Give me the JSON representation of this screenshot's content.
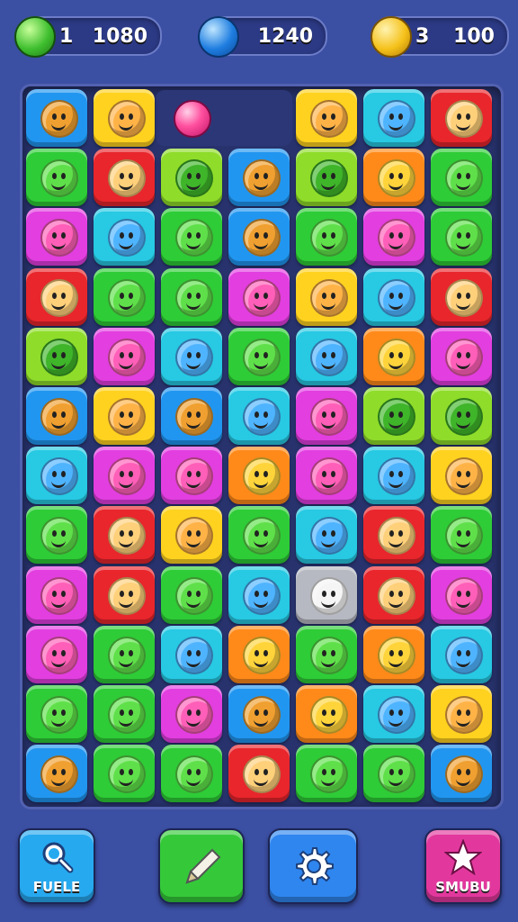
{
  "hud": {
    "green": {
      "count": "1",
      "score": "1080",
      "color": "#3fbf2f"
    },
    "blue": {
      "count": "",
      "score": "1240",
      "color": "#1e7de0"
    },
    "gold": {
      "count": "3",
      "score": "100",
      "color": "#f5c11a"
    }
  },
  "palette": {
    "blue": "#2196f0",
    "yellow": "#ffd21f",
    "red": "#e8262c",
    "green": "#2ecc37",
    "lime": "#8fdc2a",
    "orange": "#ff8a1a",
    "magenta": "#e23ee0",
    "cyan": "#27c9e3",
    "gray": "#b7b9c2"
  },
  "board": {
    "rows": [
      [
        "blue",
        "yellow",
        "empty",
        "empty",
        "yellow",
        "cyan",
        "red"
      ],
      [
        "green",
        "red",
        "lime",
        "blue",
        "lime",
        "orange",
        "green"
      ],
      [
        "magenta",
        "cyan",
        "green",
        "blue",
        "green",
        "magenta",
        "green"
      ],
      [
        "red",
        "green",
        "green",
        "magenta",
        "yellow",
        "cyan",
        "red"
      ],
      [
        "lime",
        "magenta",
        "cyan",
        "green",
        "cyan",
        "orange",
        "magenta"
      ],
      [
        "blue",
        "yellow",
        "blue",
        "cyan",
        "magenta",
        "lime",
        "lime"
      ],
      [
        "cyan",
        "magenta",
        "magenta",
        "orange",
        "magenta",
        "cyan",
        "yellow"
      ],
      [
        "green",
        "red",
        "yellow",
        "green",
        "cyan",
        "red",
        "green"
      ],
      [
        "magenta",
        "red",
        "green",
        "cyan",
        "gray",
        "red",
        "magenta"
      ],
      [
        "magenta",
        "green",
        "cyan",
        "orange",
        "green",
        "orange",
        "cyan"
      ],
      [
        "green",
        "green",
        "magenta",
        "blue",
        "orange",
        "cyan",
        "yellow"
      ],
      [
        "blue",
        "green",
        "green",
        "red",
        "green",
        "green",
        "blue"
      ]
    ]
  },
  "buttons": {
    "find": {
      "label": "FUELE",
      "color": "#27a9ef"
    },
    "pencil": {
      "label": "",
      "color": "#35c93a"
    },
    "settings": {
      "label": "",
      "color": "#2f86ef"
    },
    "star": {
      "label": "SMUBU",
      "color": "#e2389d"
    }
  }
}
